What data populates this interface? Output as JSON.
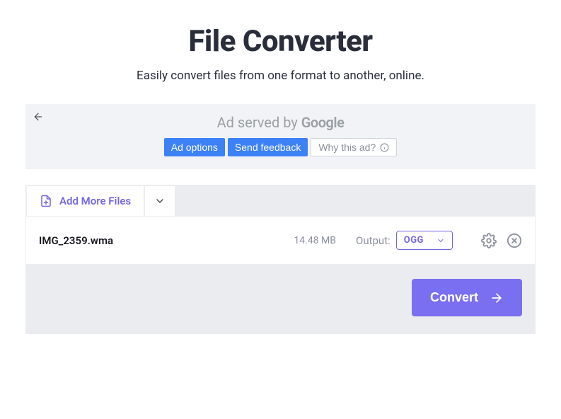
{
  "header": {
    "title": "File Converter",
    "subtitle": "Easily convert files from one format to another, online."
  },
  "ad": {
    "served_prefix": "Ad served by ",
    "served_brand": "Google",
    "options_label": "Ad options",
    "feedback_label": "Send feedback",
    "why_label": "Why this ad?"
  },
  "toolbar": {
    "add_more_label": "Add More Files"
  },
  "files": [
    {
      "name": "IMG_2359.wma",
      "size": "14.48 MB",
      "output_label": "Output:",
      "output_format": "OGG"
    }
  ],
  "actions": {
    "convert_label": "Convert"
  }
}
